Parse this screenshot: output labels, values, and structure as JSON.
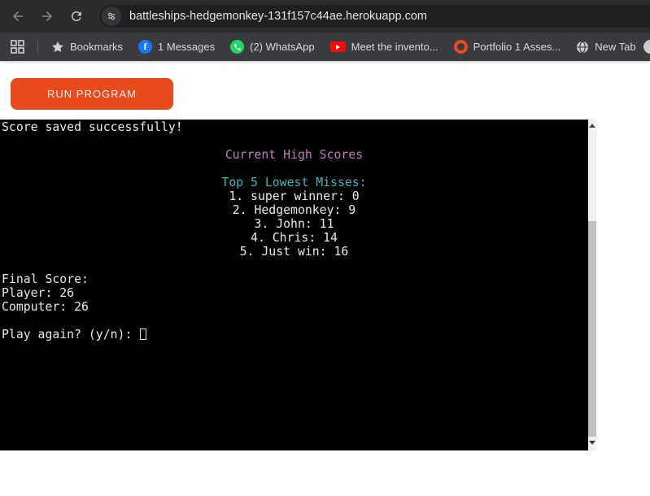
{
  "browser": {
    "toolbar": {
      "url": "battleships-hedgemonkey-131f157c44ae.herokuapp.com"
    },
    "bookmarks": {
      "items": [
        {
          "icon": "star-icon",
          "label": "Bookmarks"
        },
        {
          "icon": "facebook-icon",
          "label": "1 Messages"
        },
        {
          "icon": "whatsapp-icon",
          "label": "(2) WhatsApp"
        },
        {
          "icon": "youtube-icon",
          "label": "Meet the invento..."
        },
        {
          "icon": "portfolio-ring-icon",
          "label": "Portfolio 1 Asses..."
        },
        {
          "icon": "globe-icon",
          "label": "New Tab"
        }
      ]
    }
  },
  "page": {
    "run_button": "RUN PROGRAM"
  },
  "terminal": {
    "lines": [
      {
        "text": "Score saved successfully!",
        "color": "white",
        "align": "left"
      },
      {
        "text": "",
        "color": "white",
        "align": "left"
      },
      {
        "text": "Current High Scores",
        "color": "plum",
        "align": "center"
      },
      {
        "text": "",
        "color": "white",
        "align": "left"
      },
      {
        "text": "Top 5 Lowest Misses:",
        "color": "teal",
        "align": "center"
      },
      {
        "text": "1. super winner: 0",
        "color": "white",
        "align": "center"
      },
      {
        "text": "2. Hedgemonkey: 9",
        "color": "white",
        "align": "center"
      },
      {
        "text": "3. John: 11",
        "color": "white",
        "align": "center"
      },
      {
        "text": "4. Chris: 14",
        "color": "white",
        "align": "center"
      },
      {
        "text": "5. Just win: 16",
        "color": "white",
        "align": "center"
      },
      {
        "text": "",
        "color": "white",
        "align": "left"
      },
      {
        "text": "Final Score:",
        "color": "white",
        "align": "left"
      },
      {
        "text": "Player: 26",
        "color": "white",
        "align": "left"
      },
      {
        "text": "Computer: 26",
        "color": "white",
        "align": "left"
      },
      {
        "text": "",
        "color": "white",
        "align": "left"
      },
      {
        "text": "Play again? (y/n): ",
        "color": "white",
        "align": "left"
      }
    ],
    "colors": {
      "background": "#000000",
      "text": "#e8e8e8",
      "plum": "#bd7ebe",
      "teal": "#2fbbbb"
    }
  },
  "theme": {
    "accent_orange": "#e8491d",
    "toolbar_bg": "#2b2c2e",
    "bookmarks_bg": "#3a3b3e"
  }
}
